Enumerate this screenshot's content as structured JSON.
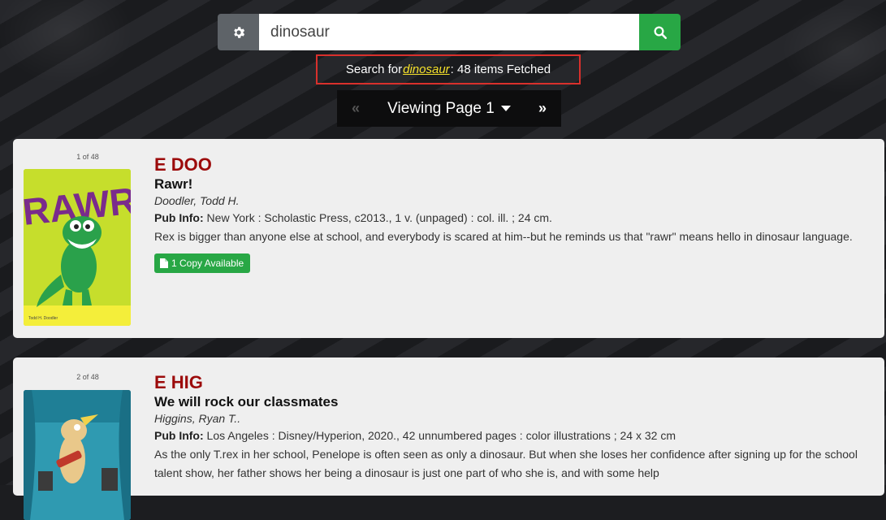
{
  "search": {
    "query": "dinosaur",
    "settings_icon": "gear-icon",
    "search_icon": "search-icon"
  },
  "status": {
    "prefix": "Search for ",
    "term": "dinosaur",
    "suffix": ": 48 items Fetched"
  },
  "pager": {
    "prev_label": "«",
    "view_label": "Viewing Page 1",
    "next_label": "»"
  },
  "results": [
    {
      "counter": "1 of 48",
      "call_number": "E DOO",
      "title": "Rawr!",
      "author": "Doodler, Todd H.",
      "pub_label": "Pub Info:",
      "pub_info": "New York : Scholastic Press, c2013., 1 v. (unpaged) : col. ill. ; 24 cm.",
      "description": "Rex is bigger than anyone else at school, and everybody is scared at him--but he reminds us that \"rawr\" means hello in dinosaur language.",
      "availability": "1 Copy Available",
      "cover_text": "RAWR!",
      "cover_author": "Todd H. Doodler"
    },
    {
      "counter": "2 of 48",
      "call_number": "E HIG",
      "title": "We will rock our classmates",
      "author": "Higgins, Ryan T..",
      "pub_label": "Pub Info:",
      "pub_info": "Los Angeles : Disney/Hyperion, 2020., 42 unnumbered pages : color illustrations ; 24 x 32 cm",
      "description": "As the only T.rex in her school, Penelope is often seen as only a dinosaur. But when she loses her confidence after signing up for the school talent show, her father shows her being a dinosaur is just one part of who she is, and with some help"
    }
  ],
  "colors": {
    "accent_green": "#28a745",
    "call_number_red": "#9c0b0b",
    "highlight_yellow": "#f5e12b",
    "status_border_red": "#d9302c"
  }
}
